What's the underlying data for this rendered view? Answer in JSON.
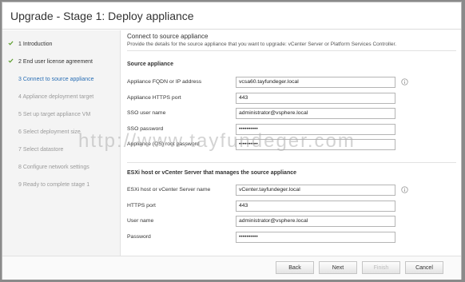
{
  "window": {
    "title": "Upgrade - Stage 1: Deploy appliance"
  },
  "steps": [
    {
      "label": "1 Introduction",
      "state": "done"
    },
    {
      "label": "2 End user license agreement",
      "state": "done"
    },
    {
      "label": "3 Connect to source appliance",
      "state": "active"
    },
    {
      "label": "4 Appliance deployment target",
      "state": "pending"
    },
    {
      "label": "5 Set up target appliance VM",
      "state": "pending"
    },
    {
      "label": "6 Select deployment size",
      "state": "pending"
    },
    {
      "label": "7 Select datastore",
      "state": "pending"
    },
    {
      "label": "8 Configure network settings",
      "state": "pending"
    },
    {
      "label": "9 Ready to complete stage 1",
      "state": "pending"
    }
  ],
  "page": {
    "heading": "Connect to source appliance",
    "description": "Provide the details for the source appliance that you want to upgrade: vCenter Server or Platform Services Controller."
  },
  "source": {
    "title": "Source appliance",
    "fields": [
      {
        "label": "Appliance FQDN or IP address",
        "value": "vcsa60.tayfundeger.local",
        "info": true
      },
      {
        "label": "Appliance HTTPS port",
        "value": "443",
        "info": false
      },
      {
        "label": "SSO user name",
        "value": "administrator@vsphere.local",
        "info": false
      },
      {
        "label": "SSO password",
        "value": "••••••••••",
        "info": false
      },
      {
        "label": "Appliance (OS) root password",
        "value": "••••••••••",
        "info": false
      }
    ]
  },
  "esxi": {
    "title": "ESXi host or vCenter Server that manages the source appliance",
    "fields": [
      {
        "label": "ESXi host or vCenter Server name",
        "value": "vCenter.tayfundeger.local",
        "info": true
      },
      {
        "label": "HTTPS port",
        "value": "443",
        "info": false
      },
      {
        "label": "User name",
        "value": "administrator@vsphere.local",
        "info": false
      },
      {
        "label": "Password",
        "value": "••••••••••",
        "info": false
      }
    ]
  },
  "footer": {
    "back": "Back",
    "next": "Next",
    "finish": "Finish",
    "cancel": "Cancel"
  },
  "watermark": "http://www.tayfundeger.com",
  "colors": {
    "active_step": "#2a6fb5",
    "check": "#5a9c2a"
  }
}
